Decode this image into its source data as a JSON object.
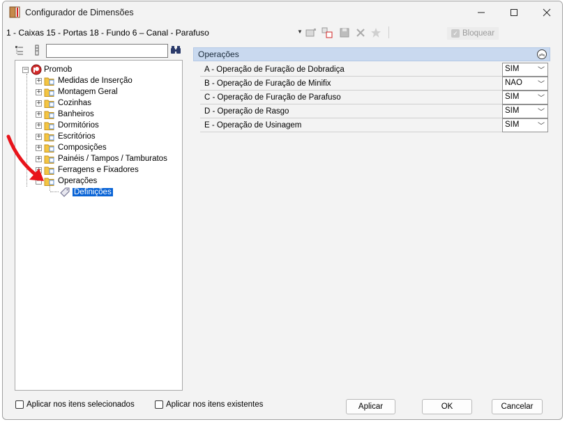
{
  "window": {
    "title": "Configurador de Dimensões"
  },
  "toolbar": {
    "config_value": "1 - Caixas 15 - Portas 18 - Fundo 6 – Canal - Parafuso",
    "lock_label": "Bloquear"
  },
  "tree": {
    "root": {
      "label": "Promob"
    },
    "items": [
      {
        "label": "Medidas de Inserção"
      },
      {
        "label": "Montagem Geral"
      },
      {
        "label": "Cozinhas"
      },
      {
        "label": "Banheiros"
      },
      {
        "label": "Dormitórios"
      },
      {
        "label": "Escritórios"
      },
      {
        "label": "Composições"
      },
      {
        "label": "Painéis / Tampos / Tamburatos"
      },
      {
        "label": "Ferragens e Fixadores"
      },
      {
        "label": "Operações"
      }
    ],
    "child": {
      "label": "Definições"
    }
  },
  "section": {
    "title": "Operações"
  },
  "properties": [
    {
      "label": "A - Operação de Furação de Dobradiça",
      "value": "SIM"
    },
    {
      "label": "B - Operação de Furação de Minifix",
      "value": "NAO"
    },
    {
      "label": "C - Operação de Furação de Parafuso",
      "value": "SIM"
    },
    {
      "label": "D - Operação de Rasgo",
      "value": "SIM"
    },
    {
      "label": "E - Operação de Usinagem",
      "value": "SIM"
    }
  ],
  "footer": {
    "apply_selected_label": "Aplicar nos itens selecionados",
    "apply_existing_label": "Aplicar nos itens existentes",
    "apply_button": "Aplicar",
    "ok_button": "OK",
    "cancel_button": "Cancelar"
  },
  "colors": {
    "selection": "#0a64d6",
    "section_header": "#c9d9ef",
    "annotation_arrow": "#e8141b"
  }
}
